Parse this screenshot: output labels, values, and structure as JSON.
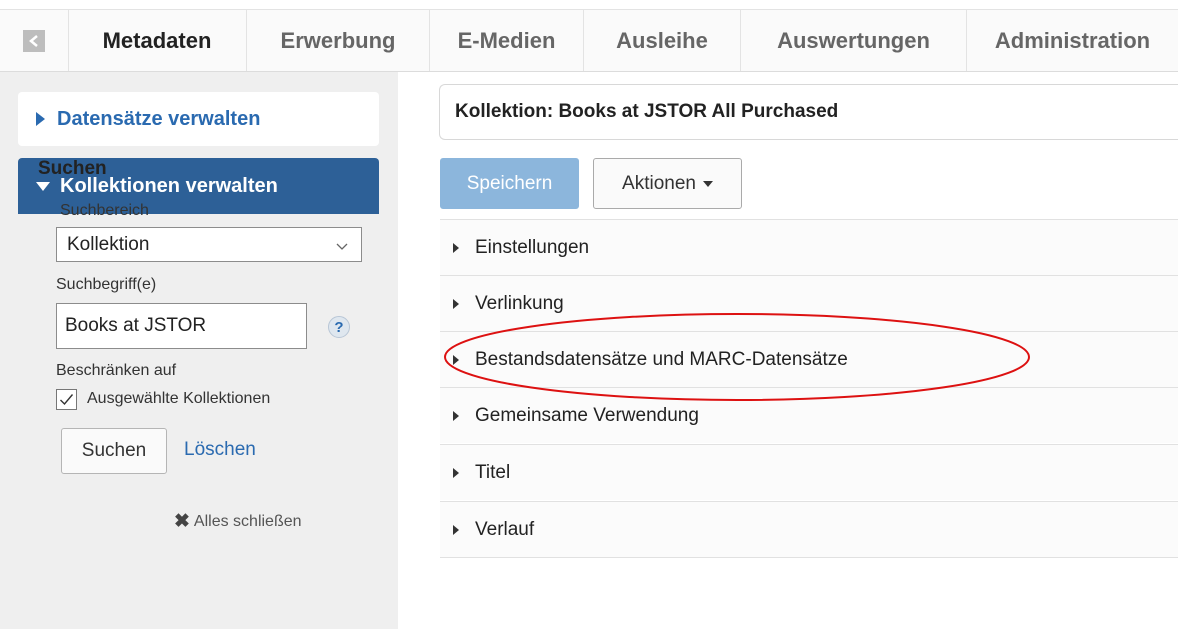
{
  "topnav": {
    "tabs": [
      {
        "label": "Metadaten",
        "active": true
      },
      {
        "label": "Erwerbung"
      },
      {
        "label": "E-Medien"
      },
      {
        "label": "Ausleihe"
      },
      {
        "label": "Auswertungen"
      },
      {
        "label": "Administration"
      }
    ]
  },
  "sidebar": {
    "panel_records": "Datensätze verwalten",
    "panel_collections": "Kollektionen verwalten",
    "search": {
      "title": "Suchen",
      "scope_label": "Suchbereich",
      "scope_value": "Kollektion",
      "term_label": "Suchbegriff(e)",
      "term_value": "Books at JSTOR",
      "help": "?",
      "restrict_label": "Beschränken auf",
      "restrict_option": "Ausgewählte Kollektionen",
      "restrict_checked": true,
      "search_button": "Suchen",
      "clear_link": "Löschen"
    },
    "close_all": "Alles schließen"
  },
  "main": {
    "header_title": "Kollektion: Books at JSTOR All Purchased",
    "save_button": "Speichern",
    "actions_button": "Aktionen",
    "sections": [
      "Einstellungen",
      "Verlinkung",
      "Bestandsdatensätze und MARC-Datensätze",
      "Gemeinsame Verwendung",
      "Titel",
      "Verlauf"
    ]
  },
  "colors": {
    "accent": "#2a6ab0",
    "panel_active_bg": "#2d6097",
    "save_disabled": "#8cb6dc",
    "annotation": "#dd1111"
  }
}
